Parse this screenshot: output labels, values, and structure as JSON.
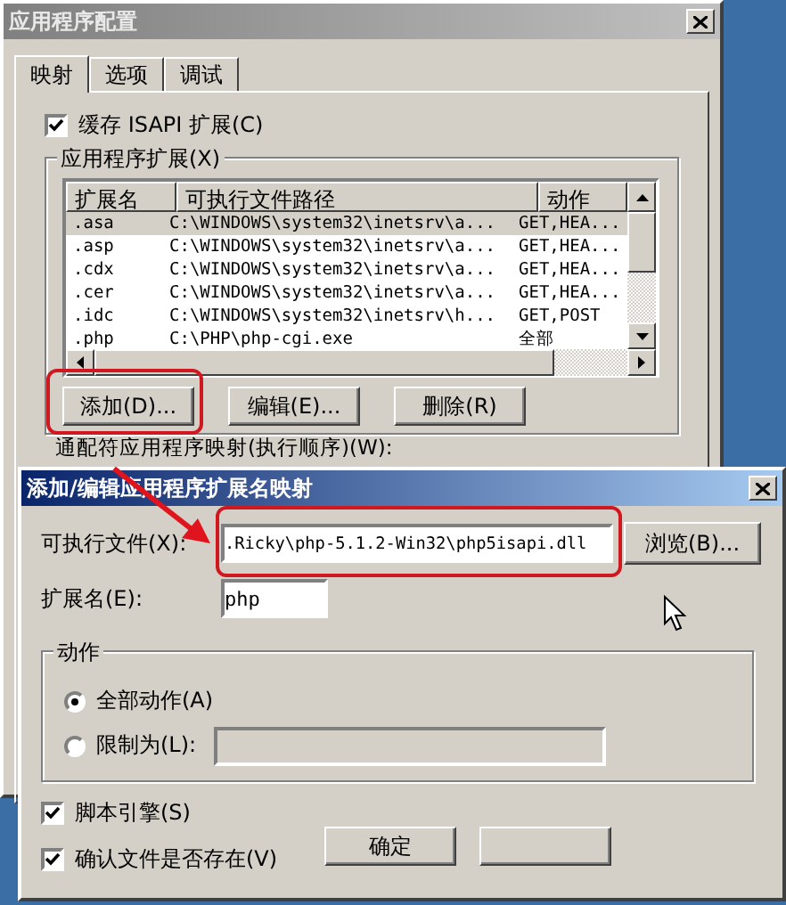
{
  "main_dialog": {
    "title": "应用程序配置",
    "tabs": [
      {
        "label": "映射",
        "selected": true
      },
      {
        "label": "选项",
        "selected": false
      },
      {
        "label": "调试",
        "selected": false
      }
    ],
    "cache_checkbox": {
      "label": "缓存 ISAPI 扩展(C)",
      "checked": true
    },
    "extensions_group": {
      "title": "应用程序扩展(X)",
      "columns": [
        "扩展名",
        "可执行文件路径",
        "动作"
      ],
      "rows": [
        {
          "cells": [
            ".asa",
            "C:\\WINDOWS\\system32\\inetsrv\\a...",
            "GET,HEA..."
          ],
          "selected": true
        },
        {
          "cells": [
            ".asp",
            "C:\\WINDOWS\\system32\\inetsrv\\a...",
            "GET,HEA..."
          ],
          "selected": false
        },
        {
          "cells": [
            ".cdx",
            "C:\\WINDOWS\\system32\\inetsrv\\a...",
            "GET,HEA..."
          ],
          "selected": false
        },
        {
          "cells": [
            ".cer",
            "C:\\WINDOWS\\system32\\inetsrv\\a...",
            "GET,HEA..."
          ],
          "selected": false
        },
        {
          "cells": [
            ".idc",
            "C:\\WINDOWS\\system32\\inetsrv\\h...",
            "GET,POST"
          ],
          "selected": false
        },
        {
          "cells": [
            ".php",
            "C:\\PHP\\php-cgi.exe",
            "全部"
          ],
          "selected": false
        }
      ],
      "buttons": [
        "添加(D)...",
        "编辑(E)...",
        "删除(R)"
      ]
    },
    "wildcard_label": "通配符应用程序映射(执行顺序)(W):"
  },
  "edit_dialog": {
    "title": "添加/编辑应用程序扩展名映射",
    "executable_label": "可执行文件(X):",
    "executable_value": ".Ricky\\php-5.1.2-Win32\\php5isapi.dll",
    "browse_button": "浏览(B)...",
    "extension_label": "扩展名(E):",
    "extension_value": "php",
    "actions_group": {
      "title": "动作",
      "options": [
        {
          "label": "全部动作(A)",
          "selected": true
        },
        {
          "label": "限制为(L):",
          "selected": false
        }
      ]
    },
    "checkboxes": [
      {
        "label": "脚本引擎(S)",
        "checked": true
      },
      {
        "label": "确认文件是否存在(V)",
        "checked": true
      }
    ],
    "buttons": [
      "确定"
    ]
  }
}
